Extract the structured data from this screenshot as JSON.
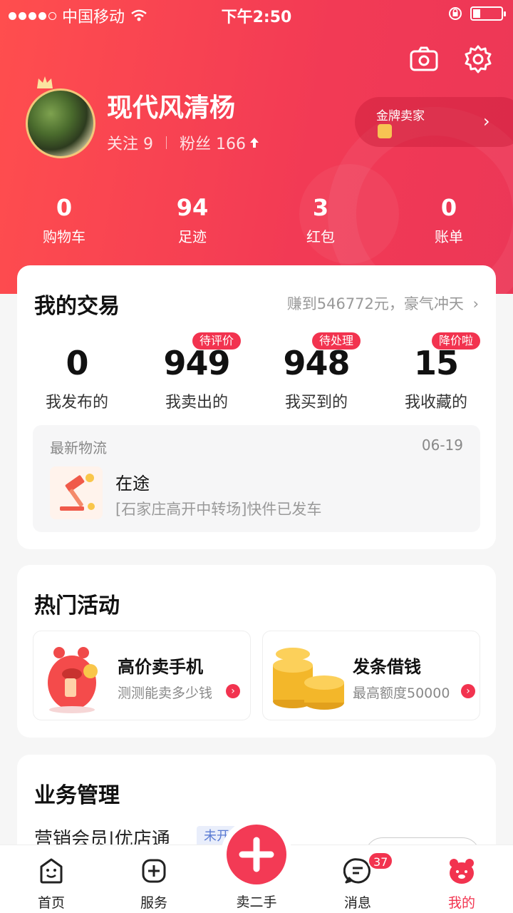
{
  "status_bar": {
    "carrier": "中国移动",
    "time": "下午2:50"
  },
  "profile": {
    "name": "现代风清杨",
    "following_label": "关注",
    "following_count": "9",
    "fans_label": "粉丝",
    "fans_count": "166",
    "gold_seller_label": "金牌卖家"
  },
  "stats": [
    {
      "value": "0",
      "label": "购物车"
    },
    {
      "value": "94",
      "label": "足迹"
    },
    {
      "value": "3",
      "label": "红包"
    },
    {
      "value": "0",
      "label": "账单"
    }
  ],
  "trade": {
    "title": "我的交易",
    "earn_text": "赚到546772元，豪气冲天",
    "items": [
      {
        "value": "0",
        "label": "我发布的",
        "badge": ""
      },
      {
        "value": "949",
        "label": "我卖出的",
        "badge": "待评价"
      },
      {
        "value": "948",
        "label": "我买到的",
        "badge": "待处理"
      },
      {
        "value": "15",
        "label": "我收藏的",
        "badge": "降价啦"
      }
    ],
    "logistics": {
      "title": "最新物流",
      "date": "06-19",
      "status": "在途",
      "desc": "[石家庄高开中转场]快件已发车"
    }
  },
  "hot": {
    "title": "热门活动",
    "items": [
      {
        "title": "高价卖手机",
        "sub": "测测能卖多少钱"
      },
      {
        "title": "发条借钱",
        "sub": "最高额度50000"
      }
    ]
  },
  "business": {
    "title": "业务管理",
    "item": "营销会员|优店通",
    "tag": "未开"
  },
  "tabbar": {
    "home": "首页",
    "service": "服务",
    "sell": "卖二手",
    "message": "消息",
    "message_badge": "37",
    "mine": "我的"
  },
  "colors": {
    "accent": "#f2334f",
    "header": "#f23a55"
  }
}
